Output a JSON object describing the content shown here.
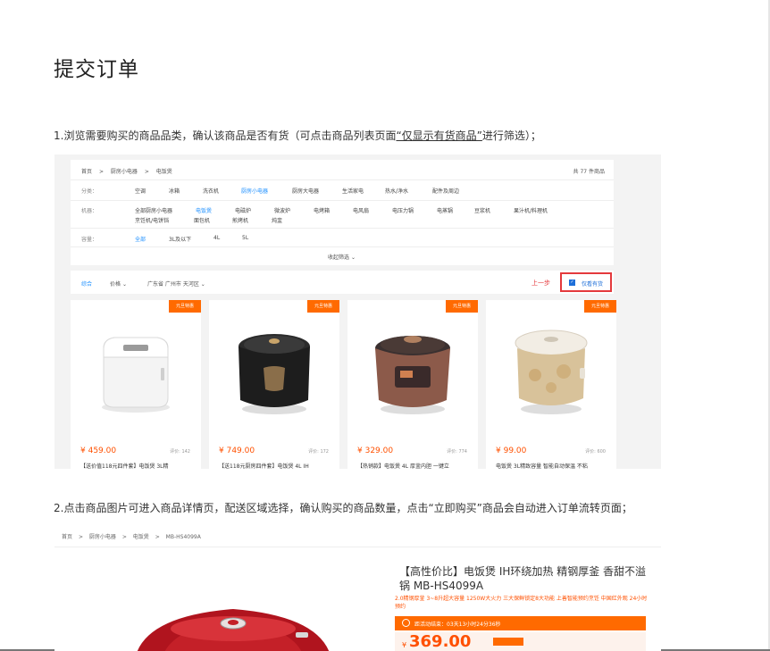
{
  "page_title": "提交订单",
  "step1": {
    "prefix": "1.浏览需要购买的商品品类，确认该商品是否有货（可点击商品列表页面",
    "link": "“仅显示有货商品”",
    "suffix": "进行筛选）；"
  },
  "step2": {
    "text": "2.点击商品图片可进入商品详情页，配送区域选择，确认购买的商品数量，点击“立即购买”商品会自动进入订单流转页面；"
  },
  "shot1": {
    "breadcrumb": [
      "首页",
      ">",
      "厨房小电器",
      ">",
      "电饭煲"
    ],
    "total": "共 77 件商品",
    "row_category": {
      "label": "分类：",
      "options": [
        "空调",
        "冰箱",
        "洗衣机",
        "厨房小电器",
        "厨房大电器",
        "生活家电",
        "热水/净水",
        "配件及周边"
      ]
    },
    "row_model": {
      "label": "机器：",
      "options": [
        "全部厨房小电器",
        "电饭煲",
        "电磁炉",
        "微波炉",
        "电烤箱",
        "电风扇",
        "电压力锅",
        "电蒸锅",
        "豆浆机",
        "果汁机/料理机",
        "烹饪机/电饼铛",
        "面包机",
        "煎烤机",
        "炖盅"
      ]
    },
    "row_capacity": {
      "label": "容量：",
      "options": [
        "全部",
        "3L及以下",
        "4L",
        "5L"
      ]
    },
    "collapse": "收起筛选",
    "sort": {
      "comprehensive": "综合",
      "price": "价格",
      "region": "广东省 广州市 天河区",
      "prev": "上一步",
      "stock_only": "仅看有货"
    },
    "products": [
      {
        "badge": "元旦特惠",
        "price": "¥ 459.00",
        "reviews": "评价: 142",
        "name": "【送价值118元四件套】电饭煲 3L精"
      },
      {
        "badge": "元旦特惠",
        "price": "¥ 749.00",
        "reviews": "评价: 172",
        "name": "【送118元厨房四件套】电饭煲 4L IH"
      },
      {
        "badge": "元旦特惠",
        "price": "¥ 329.00",
        "reviews": "评价: 774",
        "name": "【热销款】电饭煲 4L 厚釜内胆 一键立"
      },
      {
        "badge": "元旦特惠",
        "price": "¥ 99.00",
        "reviews": "评价: 600",
        "name": "电饭煲 3L精致容量 智能自动保温 不粘"
      }
    ]
  },
  "shot2": {
    "breadcrumb": [
      "首页",
      ">",
      "厨房小电器",
      ">",
      "电饭煲",
      ">",
      "MB-HS4099A"
    ],
    "title": "【高性价比】电饭煲 IH环绕加热 精钢厚釜 香甜不溢锅 MB-HS4099A",
    "promo": "2.0精钢厚釜 3~8升超大容量 1250W大火力 三大保鲜锁定8大功能 上善智能预约烹饪 中国红外观 24小时预约",
    "countdown": "距活动结束：03天13小时24分36秒",
    "currency": "¥",
    "price": "369.00"
  },
  "colors": {
    "accent_orange": "#ff6a00",
    "price_red": "#ff5000",
    "highlight_red": "#e4393c",
    "link_blue": "#1e90ff"
  }
}
